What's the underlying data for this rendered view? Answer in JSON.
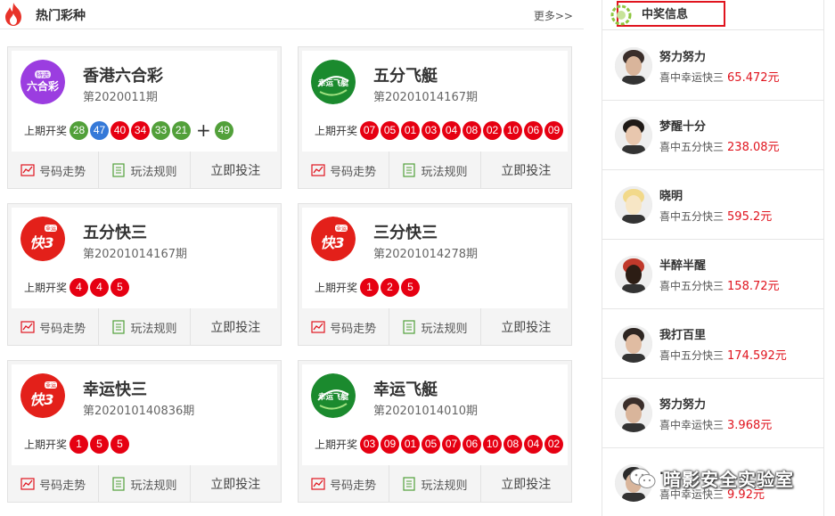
{
  "hot": {
    "title": "热门彩种",
    "more": "更多>>"
  },
  "draw_label": "上期开奖",
  "actions": {
    "trend": "号码走势",
    "rules": "玩法规则",
    "bet": "立即投注"
  },
  "games": [
    {
      "name": "香港六合彩",
      "period": "第2020011期",
      "logo_text": "六合彩",
      "logo_small": "特选",
      "balls": [
        {
          "n": "28",
          "c": "green"
        },
        {
          "n": "47",
          "c": "blue"
        },
        {
          "n": "40",
          "c": "red"
        },
        {
          "n": "34",
          "c": "red"
        },
        {
          "n": "33",
          "c": "green"
        },
        {
          "n": "21",
          "c": "green"
        }
      ],
      "special_ball": {
        "n": "49",
        "c": "green"
      },
      "plus": "+"
    },
    {
      "name": "五分飞艇",
      "period": "第20201014167期",
      "logo_text": "幸运飞艇",
      "balls": [
        {
          "n": "07",
          "c": "red"
        },
        {
          "n": "05",
          "c": "red"
        },
        {
          "n": "01",
          "c": "red"
        },
        {
          "n": "03",
          "c": "red"
        },
        {
          "n": "04",
          "c": "red"
        },
        {
          "n": "08",
          "c": "red"
        },
        {
          "n": "02",
          "c": "red"
        },
        {
          "n": "10",
          "c": "red"
        },
        {
          "n": "06",
          "c": "red"
        },
        {
          "n": "09",
          "c": "red"
        }
      ]
    },
    {
      "name": "五分快三",
      "period": "第20201014167期",
      "logo_text": "快3",
      "logo_small": "幸运",
      "balls": [
        {
          "n": "4",
          "c": "red"
        },
        {
          "n": "4",
          "c": "red"
        },
        {
          "n": "5",
          "c": "red"
        }
      ]
    },
    {
      "name": "三分快三",
      "period": "第20201014278期",
      "logo_text": "快3",
      "logo_small": "幸运",
      "balls": [
        {
          "n": "1",
          "c": "red"
        },
        {
          "n": "2",
          "c": "red"
        },
        {
          "n": "5",
          "c": "red"
        }
      ]
    },
    {
      "name": "幸运快三",
      "period": "第202010140836期",
      "logo_text": "快3",
      "logo_small": "幸运",
      "balls": [
        {
          "n": "1",
          "c": "red"
        },
        {
          "n": "5",
          "c": "red"
        },
        {
          "n": "5",
          "c": "red"
        }
      ]
    },
    {
      "name": "幸运飞艇",
      "period": "第20201014010期",
      "logo_text": "幸运飞艇",
      "balls": [
        {
          "n": "03",
          "c": "red"
        },
        {
          "n": "09",
          "c": "red"
        },
        {
          "n": "01",
          "c": "red"
        },
        {
          "n": "05",
          "c": "red"
        },
        {
          "n": "07",
          "c": "red"
        },
        {
          "n": "06",
          "c": "red"
        },
        {
          "n": "10",
          "c": "red"
        },
        {
          "n": "08",
          "c": "red"
        },
        {
          "n": "04",
          "c": "red"
        },
        {
          "n": "02",
          "c": "red"
        }
      ]
    }
  ],
  "winners": {
    "title": "中奖信息",
    "prefix": "喜中",
    "suffix": "元",
    "items": [
      {
        "user": "努力努力",
        "game": "幸运快三",
        "amount": "65.472"
      },
      {
        "user": "梦醒十分",
        "game": "五分快三",
        "amount": "238.08"
      },
      {
        "user": "晓明",
        "game": "五分快三",
        "amount": "595.2"
      },
      {
        "user": "半醉半醒",
        "game": "五分快三",
        "amount": "158.72"
      },
      {
        "user": "我打百里",
        "game": "五分快三",
        "amount": "174.592"
      },
      {
        "user": "努力努力",
        "game": "幸运快三",
        "amount": "3.968"
      },
      {
        "user": "...",
        "game": "幸运快三",
        "amount": "9.92"
      }
    ]
  },
  "watermark": "暗影安全实验室",
  "colors": {
    "accent_red": "#e0141e",
    "ball_red": "#e60012",
    "ball_green": "#52a03a",
    "ball_blue": "#3579d8",
    "logo_purple": "#9b3de0",
    "logo_green": "#1b8a2e",
    "logo_red": "#e3201a"
  }
}
